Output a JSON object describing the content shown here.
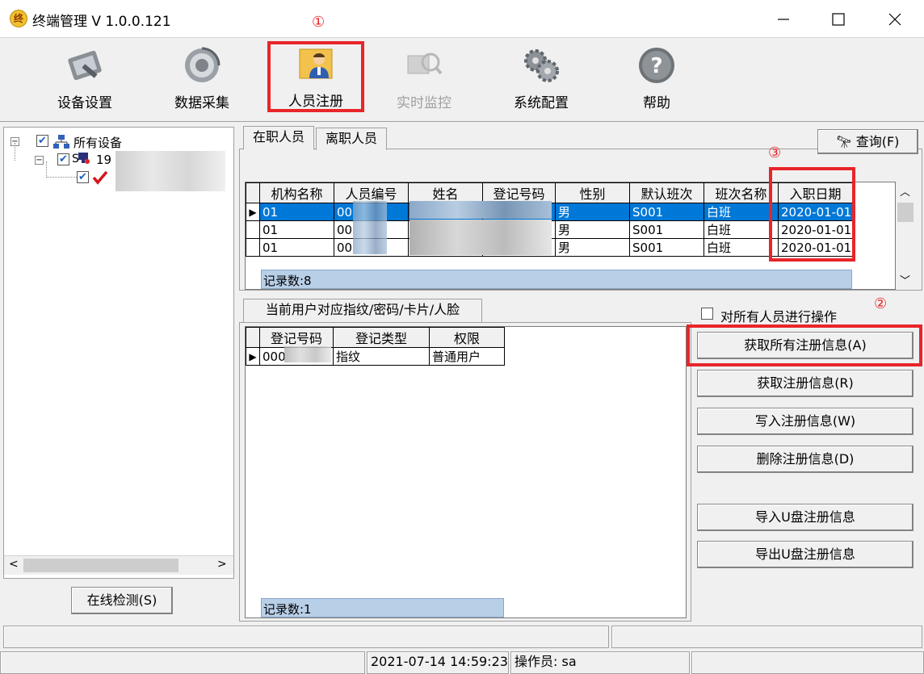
{
  "window": {
    "title": "终端管理 V 1.0.0.121",
    "app_icon_text": "终",
    "controls": [
      "minimize",
      "maximize",
      "close"
    ]
  },
  "toolbar": {
    "items": [
      {
        "label": "设备设置",
        "icon": "device-settings-icon",
        "enabled": true
      },
      {
        "label": "数据采集",
        "icon": "data-collect-icon",
        "enabled": true
      },
      {
        "label": "人员注册",
        "icon": "person-register-icon",
        "enabled": true
      },
      {
        "label": "实时监控",
        "icon": "realtime-monitor-icon",
        "enabled": false
      },
      {
        "label": "系统配置",
        "icon": "system-config-icon",
        "enabled": true
      },
      {
        "label": "帮助",
        "icon": "help-icon",
        "enabled": true
      }
    ]
  },
  "annotations": {
    "step1": "①",
    "step2": "②",
    "step3": "③",
    "highlight_color": "#e8252a"
  },
  "tree": {
    "root_label": "所有设备",
    "child_label": "19",
    "child_prefix": "S"
  },
  "left_panel": {
    "online_check_button": "在线检测(S)"
  },
  "employee_tabs": {
    "active": "在职人员",
    "inactive": "离职人员"
  },
  "query_button": "查询(F)",
  "employee_table": {
    "columns": [
      "机构名称",
      "人员编号",
      "姓名",
      "登记号码",
      "性别",
      "默认班次",
      "班次名称",
      "入职日期"
    ],
    "rows": [
      {
        "org": "01",
        "id": "00",
        "name": "",
        "reg": "",
        "gender": "男",
        "shift": "S001",
        "shift_name": "白班",
        "date": "2020-01-01",
        "selected": true
      },
      {
        "org": "01",
        "id": "00",
        "name": "",
        "reg": "",
        "gender": "男",
        "shift": "S001",
        "shift_name": "白班",
        "date": "2020-01-01",
        "selected": false
      },
      {
        "org": "01",
        "id": "00",
        "name": "",
        "reg": "",
        "gender": "男",
        "shift": "S001",
        "shift_name": "白班",
        "date": "2020-01-01",
        "selected": false
      }
    ],
    "record_count": "记录数:8"
  },
  "credential_tab": "当前用户对应指纹/密码/卡片/人脸",
  "credential_table": {
    "columns": [
      "登记号码",
      "登记类型",
      "权限"
    ],
    "rows": [
      {
        "reg": "000",
        "type": "指纹",
        "perm": "普通用户"
      }
    ],
    "record_count": "记录数:1"
  },
  "actions": {
    "all_checkbox_label": "对所有人员进行操作",
    "get_all": "获取所有注册信息(A)",
    "get": "获取注册信息(R)",
    "write": "写入注册信息(W)",
    "delete": "删除注册信息(D)",
    "import_usb": "导入U盘注册信息",
    "export_usb": "导出U盘注册信息"
  },
  "status": {
    "datetime": "2021-07-14 14:59:23",
    "operator": "操作员: sa"
  }
}
